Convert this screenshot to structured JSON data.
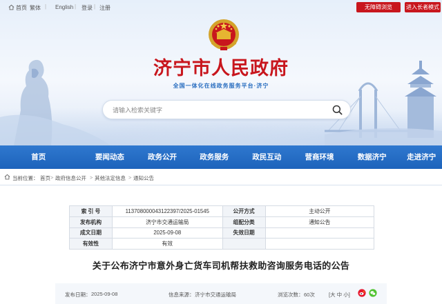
{
  "topbar": {
    "home_link": "首页",
    "traditional_link": "繁体",
    "english_link": "English",
    "login_link": "登录",
    "register_link": "注册",
    "accessibility_button": "无障碍浏览",
    "elderly_mode_button": "进入长者模式"
  },
  "header": {
    "title": "济宁市人民政府",
    "subtitle": "全国一体化在线政务服务平台·济宁",
    "search_placeholder": "请输入检索关键字"
  },
  "nav": {
    "items": [
      "首页",
      "要闻动态",
      "政务公开",
      "政务服务",
      "政民互动",
      "营商环境",
      "数据济宁",
      "走进济宁"
    ]
  },
  "breadcrumb": {
    "prefix": "当前位置：",
    "items": [
      "首页",
      "政府信息公开",
      "其他法定信息",
      "通知公告"
    ]
  },
  "info": {
    "index_label": "索  引  号",
    "index_value": "11370800004312239​7/2025-01545",
    "disclosure_label": "公开方式",
    "disclosure_value": "主动公开",
    "issuer_label": "发布机构",
    "issuer_value": "济宁市交通运输局",
    "category_label": "组配分类",
    "category_value": "通知公告",
    "date_label": "成文日期",
    "date_value": "2025-09-08",
    "expiry_label": "失效日期",
    "expiry_value": "",
    "validity_label": "有效性",
    "validity_value": "有效"
  },
  "document": {
    "title": "关于公布济宁市意外身亡货车司机帮扶救助咨询服务电话的公告"
  },
  "meta": {
    "date_label": "发布日期：",
    "date_value": "2025-09-08",
    "source_label": "信息来源：",
    "source_value": "济宁市交通运输局",
    "views_label": "浏览次数：",
    "views_value": "60次",
    "font_label": "[大 中 小]"
  },
  "colors": {
    "brand_red": "#c8161d",
    "nav_blue": "#1d63bb",
    "accent_blue": "#2b6fc0"
  }
}
